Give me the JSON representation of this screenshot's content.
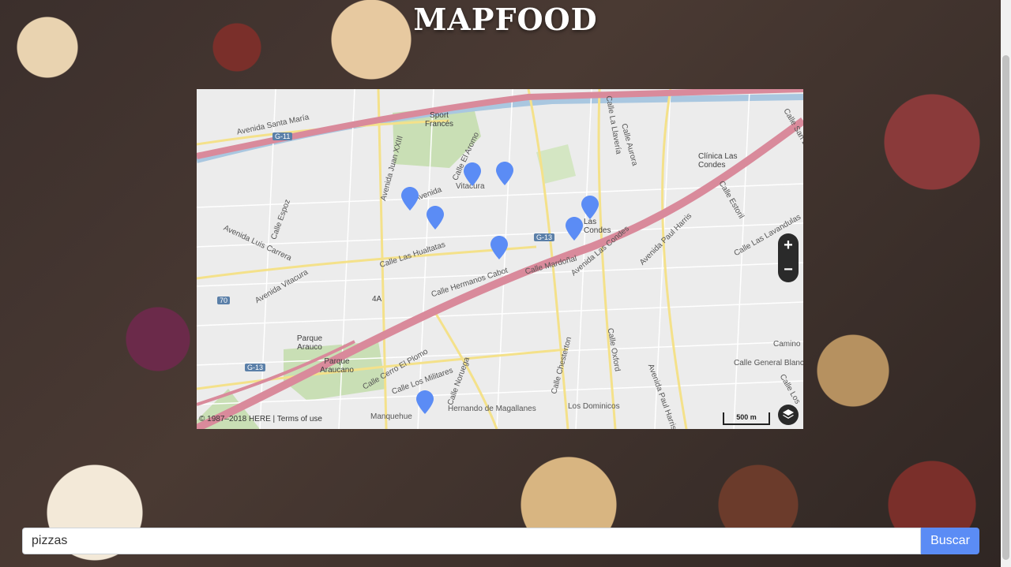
{
  "app": {
    "title": "MAPFOOD"
  },
  "map": {
    "streets": [
      "Avenida Santa María",
      "Avenida Juan XXIII",
      "Calle El Aromo",
      "Vitacura",
      "Calle La Llavería",
      "Calle Aurora",
      "Avenida",
      "Calle Espoz",
      "Avenida Luis Carrera",
      "Calle Las Hualtatas",
      "Avenida Vitacura",
      "Calle Hermanos Cabot",
      "Calle Mardoñal",
      "Avenida Las Condes",
      "Avenida Paul Harris",
      "Calle Estoril",
      "Calle Las Lavandulas",
      "Calle Cerro El Plomo",
      "Calle Los Militares",
      "Calle Noruega",
      "Calle Chesterton",
      "Calle Oxford",
      "Avenida Paul Harris",
      "Calle General Blanche",
      "Camino",
      "Calle San Damián",
      "Manquehue",
      "Hernando de Magallanes",
      "Los Dominicos",
      "Calle Los"
    ],
    "pois": [
      "Sport Francés",
      "Clínica Las Condes",
      "Las Condes",
      "Parque Araucano",
      "Parque Arauco"
    ],
    "road_shields": [
      "G-11",
      "G-13",
      "G-13",
      "70",
      "4A"
    ],
    "zoom_in": "+",
    "zoom_out": "−",
    "copyright": "© 1987–2018 HERE",
    "terms": "Terms of use",
    "scale": "500 m"
  },
  "search": {
    "value": "pizzas",
    "button_label": "Buscar"
  },
  "colors": {
    "marker": "#5b8cf5",
    "highway": "#d98a9b",
    "button": "#5b8cf5"
  }
}
